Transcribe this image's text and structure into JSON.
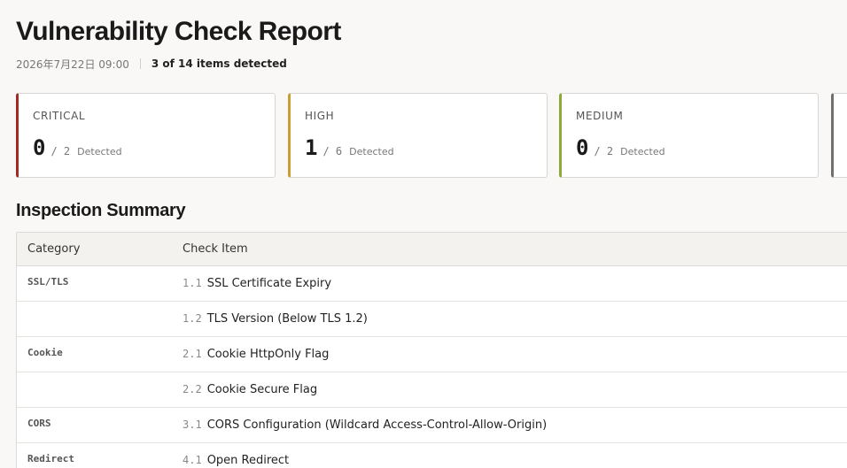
{
  "report": {
    "title": "Vulnerability Check Report",
    "date": "2026年7月22日 09:00",
    "summary": "3 of 14 items detected"
  },
  "cards": [
    {
      "label": "CRITICAL",
      "count": "0",
      "total": "/ 2",
      "detected": "Detected",
      "color": "#9e2b25"
    },
    {
      "label": "HIGH",
      "count": "1",
      "total": "/ 6",
      "detected": "Detected",
      "color": "#c6a033"
    },
    {
      "label": "MEDIUM",
      "count": "0",
      "total": "/ 2",
      "detected": "Detected",
      "color": "#8ea83a"
    },
    {
      "label": "",
      "count": "",
      "total": "",
      "detected": "",
      "color": "#707070"
    }
  ],
  "section": {
    "title": "Inspection Summary"
  },
  "table": {
    "headers": {
      "category": "Category",
      "item": "Check Item"
    },
    "rows": [
      {
        "category": "SSL/TLS",
        "num": "1.1",
        "name": "SSL Certificate Expiry"
      },
      {
        "category": "",
        "num": "1.2",
        "name": "TLS Version (Below TLS 1.2)"
      },
      {
        "category": "Cookie",
        "num": "2.1",
        "name": "Cookie HttpOnly Flag"
      },
      {
        "category": "",
        "num": "2.2",
        "name": "Cookie Secure Flag"
      },
      {
        "category": "CORS",
        "num": "3.1",
        "name": "CORS Configuration (Wildcard Access-Control-Allow-Origin)"
      },
      {
        "category": "Redirect",
        "num": "4.1",
        "name": "Open Redirect"
      }
    ]
  }
}
